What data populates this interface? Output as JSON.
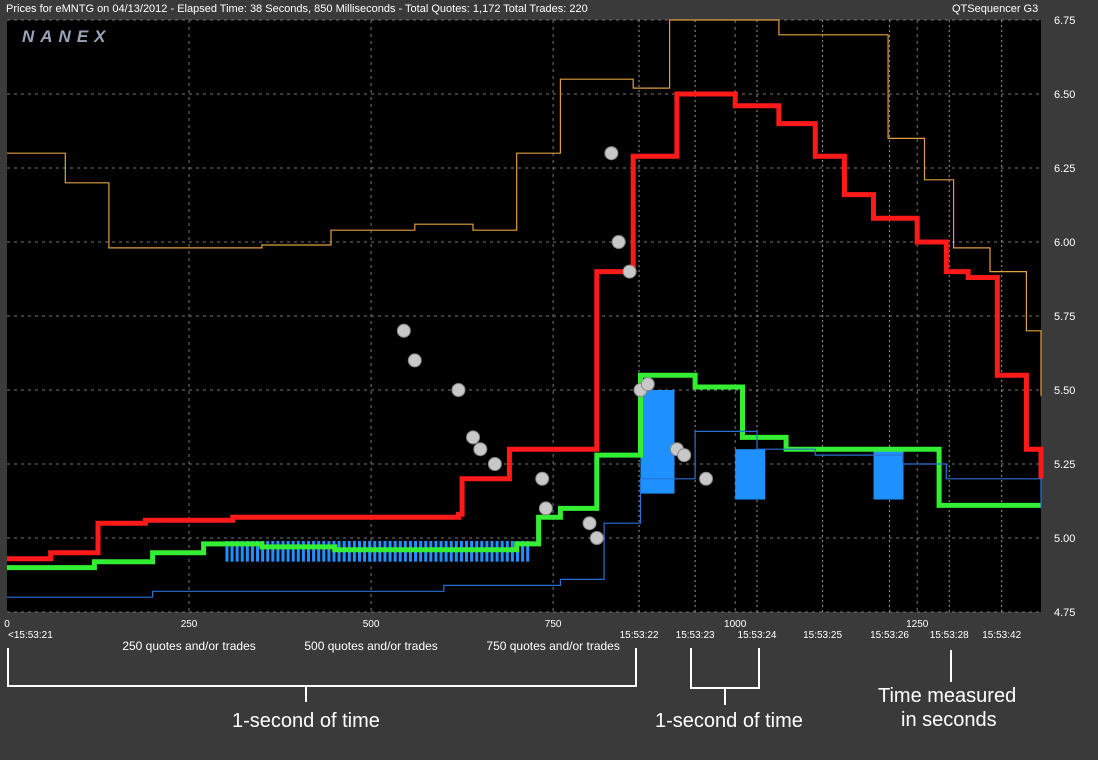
{
  "header": {
    "left": "Prices for  eMNTG  on  04/13/2012  -  Elapsed Time: 38 Seconds, 850 Milliseconds  -  Total Quotes: 1,172  Total Trades: 220",
    "right": "QTSequencer G3"
  },
  "logo": "NANEX",
  "chart_data": {
    "type": "line",
    "title": "",
    "y_axis": {
      "range": [
        4.75,
        6.75
      ],
      "ticks": [
        "6.75",
        "6.50",
        "6.25",
        "6.00",
        "5.75",
        "5.50",
        "5.25",
        "5.00",
        "4.75"
      ]
    },
    "x_axis": {
      "range": [
        0,
        1420
      ],
      "ticks": [
        {
          "label": "0",
          "x": 0
        },
        {
          "label": "250",
          "x": 250
        },
        {
          "label": "500",
          "x": 500
        },
        {
          "label": "750",
          "x": 750
        },
        {
          "label": "1000",
          "x": 1000
        },
        {
          "label": "1250",
          "x": 1250
        }
      ],
      "time_labels": [
        {
          "label": "<15:53:21",
          "x": 0
        },
        {
          "label": "15:53:22",
          "x": 868
        },
        {
          "label": "15:53:23",
          "x": 945
        },
        {
          "label": "15:53:24",
          "x": 1030
        },
        {
          "label": "15:53:25",
          "x": 1120
        },
        {
          "label": "15:53:26",
          "x": 1212
        },
        {
          "label": "15:53:28",
          "x": 1294
        },
        {
          "label": "15:53:42",
          "x": 1366
        }
      ],
      "count_labels": [
        {
          "label": "250 quotes and/or trades",
          "x": 250
        },
        {
          "label": "500 quotes and/or trades",
          "x": 500
        },
        {
          "label": "750 quotes and/or trades",
          "x": 750
        }
      ]
    },
    "series": [
      {
        "color": "#ff1a1a",
        "points": [
          [
            0,
            4.93
          ],
          [
            60,
            4.95
          ],
          [
            125,
            5.05
          ],
          [
            190,
            5.06
          ],
          [
            310,
            5.07
          ],
          [
            440,
            5.07
          ],
          [
            620,
            5.08
          ],
          [
            625,
            5.2
          ],
          [
            690,
            5.3
          ],
          [
            800,
            5.3
          ],
          [
            810,
            5.9
          ],
          [
            860,
            6.29
          ],
          [
            920,
            6.5
          ],
          [
            1000,
            6.46
          ],
          [
            1060,
            6.4
          ],
          [
            1110,
            6.29
          ],
          [
            1150,
            6.16
          ],
          [
            1190,
            6.08
          ],
          [
            1250,
            6.0
          ],
          [
            1290,
            5.9
          ],
          [
            1320,
            5.88
          ],
          [
            1360,
            5.55
          ],
          [
            1400,
            5.3
          ],
          [
            1420,
            5.2
          ]
        ]
      },
      {
        "color": "#33ee33",
        "points": [
          [
            0,
            4.9
          ],
          [
            120,
            4.92
          ],
          [
            200,
            4.95
          ],
          [
            270,
            4.98
          ],
          [
            350,
            4.97
          ],
          [
            450,
            4.96
          ],
          [
            560,
            4.96
          ],
          [
            700,
            4.98
          ],
          [
            730,
            5.07
          ],
          [
            760,
            5.1
          ],
          [
            810,
            5.28
          ],
          [
            870,
            5.55
          ],
          [
            945,
            5.51
          ],
          [
            1010,
            5.34
          ],
          [
            1070,
            5.3
          ],
          [
            1240,
            5.3
          ],
          [
            1280,
            5.11
          ],
          [
            1420,
            5.11
          ]
        ]
      },
      {
        "color": "#e0a040",
        "points": [
          [
            0,
            6.3
          ],
          [
            40,
            6.3
          ],
          [
            80,
            6.2
          ],
          [
            140,
            5.98
          ],
          [
            260,
            5.98
          ],
          [
            350,
            5.99
          ],
          [
            445,
            6.04
          ],
          [
            560,
            6.06
          ],
          [
            640,
            6.04
          ],
          [
            700,
            6.3
          ],
          [
            760,
            6.55
          ],
          [
            860,
            6.52
          ],
          [
            910,
            6.75
          ],
          [
            1000,
            6.75
          ],
          [
            1060,
            6.7
          ],
          [
            1210,
            6.35
          ],
          [
            1260,
            6.21
          ],
          [
            1300,
            5.98
          ],
          [
            1350,
            5.9
          ],
          [
            1400,
            5.7
          ],
          [
            1420,
            5.48
          ]
        ]
      },
      {
        "color": "#2a6fd4",
        "points": [
          [
            0,
            4.8
          ],
          [
            120,
            4.8
          ],
          [
            200,
            4.82
          ],
          [
            400,
            4.82
          ],
          [
            600,
            4.84
          ],
          [
            760,
            4.86
          ],
          [
            820,
            5.05
          ],
          [
            870,
            5.2
          ],
          [
            945,
            5.36
          ],
          [
            1030,
            5.3
          ],
          [
            1110,
            5.28
          ],
          [
            1230,
            5.25
          ],
          [
            1290,
            5.2
          ],
          [
            1420,
            5.1
          ]
        ]
      }
    ],
    "trade_dots_y": [
      5.7,
      5.6,
      5.5,
      5.34,
      5.3,
      5.25,
      5.2,
      5.1,
      5.05,
      5.0,
      6.3,
      6.0,
      5.9,
      5.5,
      5.52,
      5.3,
      5.28,
      5.2
    ]
  },
  "annotations": {
    "left": "1-second of time",
    "middle": "1-second of time",
    "right_line1": "Time measured",
    "right_line2": "in seconds"
  },
  "colors": {
    "bid": "#33ee33",
    "ask": "#ff1a1a",
    "spread_fill": "#1e90ff",
    "exchange_quote": "#e0a040",
    "trade": "#c8c8c8"
  }
}
